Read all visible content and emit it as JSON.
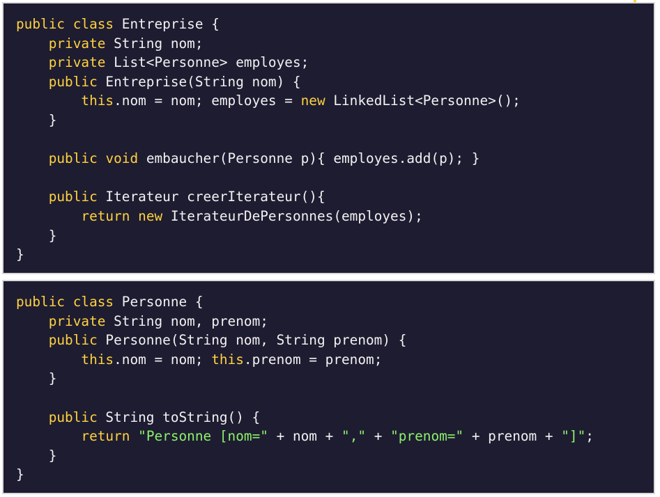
{
  "panels": [
    {
      "name": "entreprise-code-block",
      "lines": [
        [
          {
            "t": "public",
            "c": "kw"
          },
          {
            "t": " "
          },
          {
            "t": "class",
            "c": "kw"
          },
          {
            "t": " Entreprise {"
          }
        ],
        [
          {
            "t": "    "
          },
          {
            "t": "private",
            "c": "kw"
          },
          {
            "t": " String nom;"
          }
        ],
        [
          {
            "t": "    "
          },
          {
            "t": "private",
            "c": "kw"
          },
          {
            "t": " List<Personne> employes;"
          }
        ],
        [
          {
            "t": "    "
          },
          {
            "t": "public",
            "c": "kw"
          },
          {
            "t": " Entreprise(String nom) {"
          }
        ],
        [
          {
            "t": "        "
          },
          {
            "t": "this",
            "c": "kw"
          },
          {
            "t": ".nom = nom; employes = "
          },
          {
            "t": "new",
            "c": "kw"
          },
          {
            "t": " LinkedList<Personne>();"
          }
        ],
        [
          {
            "t": "    }"
          }
        ],
        [
          {
            "t": ""
          }
        ],
        [
          {
            "t": "    "
          },
          {
            "t": "public",
            "c": "kw"
          },
          {
            "t": " "
          },
          {
            "t": "void",
            "c": "kw"
          },
          {
            "t": " embaucher(Personne p){ employes.add(p); }"
          }
        ],
        [
          {
            "t": ""
          }
        ],
        [
          {
            "t": "    "
          },
          {
            "t": "public",
            "c": "kw"
          },
          {
            "t": " Iterateur creerIterateur(){"
          }
        ],
        [
          {
            "t": "        "
          },
          {
            "t": "return",
            "c": "kw"
          },
          {
            "t": " "
          },
          {
            "t": "new",
            "c": "kw"
          },
          {
            "t": " IterateurDePersonnes(employes);"
          }
        ],
        [
          {
            "t": "    }"
          }
        ],
        [
          {
            "t": "}"
          }
        ]
      ]
    },
    {
      "name": "personne-code-block",
      "lines": [
        [
          {
            "t": "public",
            "c": "kw"
          },
          {
            "t": " "
          },
          {
            "t": "class",
            "c": "kw"
          },
          {
            "t": " Personne {"
          }
        ],
        [
          {
            "t": "    "
          },
          {
            "t": "private",
            "c": "kw"
          },
          {
            "t": " String nom, prenom;"
          }
        ],
        [
          {
            "t": "    "
          },
          {
            "t": "public",
            "c": "kw"
          },
          {
            "t": " Personne(String nom, String prenom) {"
          }
        ],
        [
          {
            "t": "        "
          },
          {
            "t": "this",
            "c": "kw"
          },
          {
            "t": ".nom = nom; "
          },
          {
            "t": "this",
            "c": "kw"
          },
          {
            "t": ".prenom = prenom;"
          }
        ],
        [
          {
            "t": "    }"
          }
        ],
        [
          {
            "t": ""
          }
        ],
        [
          {
            "t": "    "
          },
          {
            "t": "public",
            "c": "kw"
          },
          {
            "t": " String toString() {"
          }
        ],
        [
          {
            "t": "        "
          },
          {
            "t": "return",
            "c": "kw"
          },
          {
            "t": " "
          },
          {
            "t": "\"Personne [nom=\"",
            "c": "str"
          },
          {
            "t": " + nom + "
          },
          {
            "t": "\",\"",
            "c": "str"
          },
          {
            "t": " + "
          },
          {
            "t": "\"prenom=\"",
            "c": "str"
          },
          {
            "t": " + prenom + "
          },
          {
            "t": "\"]\"",
            "c": "str"
          },
          {
            "t": ";"
          }
        ],
        [
          {
            "t": "    }"
          }
        ],
        [
          {
            "t": "}"
          }
        ]
      ]
    }
  ],
  "colors": {
    "background": "#1e1c31",
    "keyword": "#ffd23f",
    "string": "#8cf26a",
    "text": "#f2f2f2",
    "border": "#d9d9d9"
  }
}
